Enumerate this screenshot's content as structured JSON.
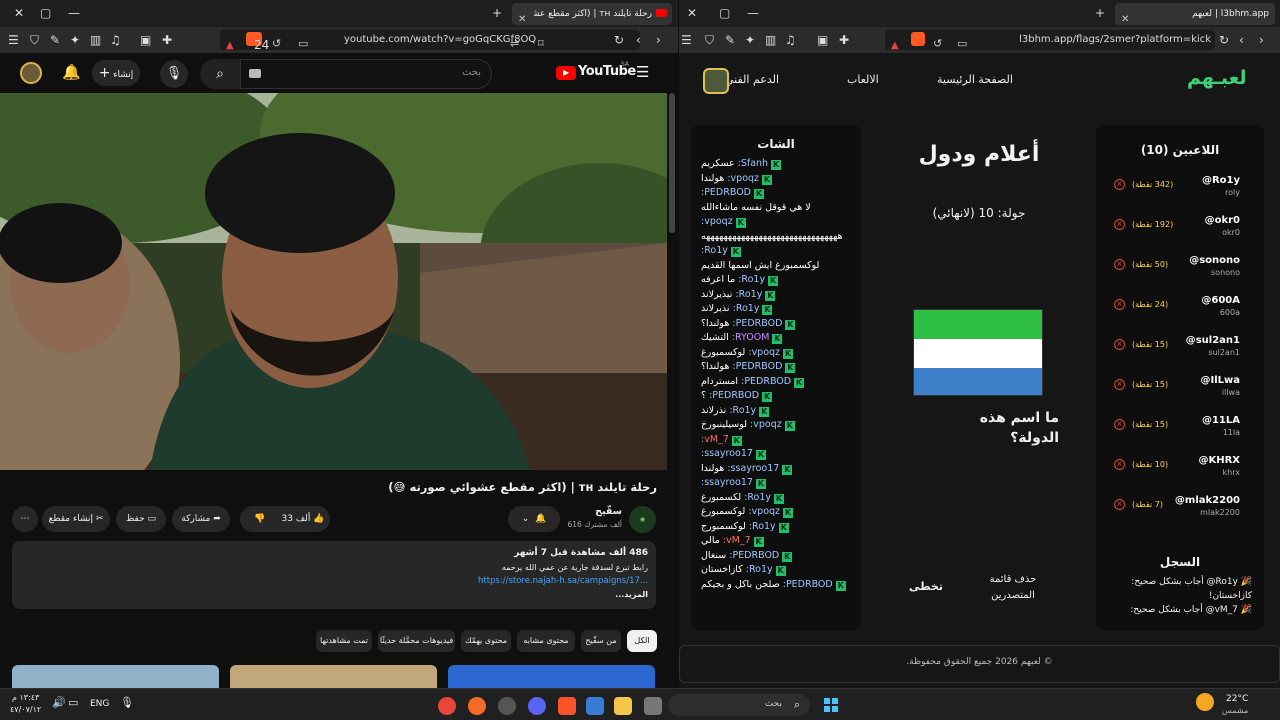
{
  "left_browser": {
    "tab_title": "رحلة تايلند ᴛʜ | (اكثر مقطع عشوائي صورته",
    "url": "youtube.com/watch?v=goGqCKGf8OQ",
    "shield_count": "24"
  },
  "youtube": {
    "logo_text": "YouTube",
    "logo_region": "SA",
    "search_placeholder": "بحث",
    "create_label": "إنشاء",
    "video_title": "رحلة تايلند ᴛʜ | (اكثر مقطع عشوائي صورته 😅)",
    "channel_name": "سقّيح",
    "subscribers": "616 ألف مشترك",
    "likes": "33 ألف",
    "share_label": "مشاركة",
    "save_label": "حفظ",
    "clip_label": "إنشاء مقطع",
    "desc_stats": "486 ألف مشاهدة قبل 7 أشهر",
    "desc_line": "رابط تبرع لسدقة جارية عن عمي الله يرحمه",
    "desc_link": "https://store.najah-h.sa/campaigns/17...",
    "desc_more": "...المزيد",
    "chips": [
      "الكل",
      "من سقّيح",
      "محتوى مشابه",
      "محتوى يهمّك",
      "فيديوهات محمَّلة حديثًا",
      "تمت مشاهدتها"
    ]
  },
  "right_browser": {
    "tab_title": "لعبهم | l3bhm.app",
    "url": "l3bhm.app/flags/2smer?platform=kick"
  },
  "game": {
    "logo": "لعبـهم",
    "nav": [
      "الصفحة الرئيسية",
      "الالعاب",
      "الدعم الفني"
    ],
    "players_title": "اللاعبين (10)",
    "players": [
      {
        "name": "@Ro1y",
        "sub": "roly",
        "points": "(342 نقطة)"
      },
      {
        "name": "@okr0",
        "sub": "okr0",
        "points": "(192 نقطة)"
      },
      {
        "name": "@sonono",
        "sub": "sonono",
        "points": "(50 نقطة)"
      },
      {
        "name": "@600A",
        "sub": "600a",
        "points": "(24 نقطة)"
      },
      {
        "name": "@sul2an1",
        "sub": "sul2an1",
        "points": "(15 نقطة)"
      },
      {
        "name": "@IlLwa",
        "sub": "illwa",
        "points": "(15 نقطة)"
      },
      {
        "name": "@11LA",
        "sub": "11la",
        "points": "(15 نقطة)"
      },
      {
        "name": "@KHRX",
        "sub": "khrx",
        "points": "(10 نقطة)"
      },
      {
        "name": "@mlak2200",
        "sub": "mlak2200",
        "points": "(7 نقطة)"
      }
    ],
    "log_title": "السجل",
    "log_lines": [
      "🎉 Ro1y@ أجاب بشكل صحيح:",
      "كازاخستان!",
      "🎉 vM_7@ أجاب بشكل صحيح:"
    ],
    "game_title": "أعلام ودول",
    "round": "جولة: 10 (لانهائي)",
    "question": "ما اسم هذه الدولة؟",
    "flag_colors": [
      "#2fbf45",
      "#ffffff",
      "#3d7fc9"
    ],
    "leaderboard_btn": "حذف قائمة المتصدرين",
    "skip_btn": "تخطى",
    "chat_title": "الشات",
    "chat": [
      {
        "n": "Sfanh",
        "m": "عسكريم"
      },
      {
        "n": "vpoqz",
        "m": "هولندا"
      },
      {
        "n": "PEDRBOD",
        "m": ""
      },
      {
        "n": "",
        "m": "لا هي قوقل نفسه ماشاءالله"
      },
      {
        "n": "vpoqz",
        "m": ""
      },
      {
        "n": "",
        "m": "هههههههههههههههههههههههههههههههه"
      },
      {
        "n": "Ro1y",
        "m": ""
      },
      {
        "n": "",
        "m": "لوكسمبورغ ايش اسمها القديم"
      },
      {
        "n": "Ro1y",
        "m": "ما اعرفه"
      },
      {
        "n": "Ro1y",
        "m": "نيذيرلاند"
      },
      {
        "n": "Ro1y",
        "m": "نذيرلاند"
      },
      {
        "n": "PEDRBOD",
        "m": "هولندا؟"
      },
      {
        "n": "RYOOM",
        "m": "التشيك"
      },
      {
        "n": "vpoqz",
        "m": "لوكسمبورغ"
      },
      {
        "n": "PEDRBOD",
        "m": "هولندا؟"
      },
      {
        "n": "PEDRBOD",
        "m": "امستردام"
      },
      {
        "n": "PEDRBOD",
        "m": "؟"
      },
      {
        "n": "Ro1y",
        "m": "نذرلاند"
      },
      {
        "n": "vpoqz",
        "m": "لوسيلينبورخ"
      },
      {
        "n": "vM_7",
        "m": ""
      },
      {
        "n": "ssayroo17",
        "m": ""
      },
      {
        "n": "ssayroo17",
        "m": "هولندا"
      },
      {
        "n": "ssayroo17",
        "m": ""
      },
      {
        "n": "Ro1y",
        "m": "لكسمبورغ"
      },
      {
        "n": "vpoqz",
        "m": "لوكسمبورغ"
      },
      {
        "n": "Ro1y",
        "m": "لوكسمبورج"
      },
      {
        "n": "vM_7",
        "m": "مالي"
      },
      {
        "n": "PEDRBOD",
        "m": "سنغال"
      },
      {
        "n": "Ro1y",
        "m": "كازاخستان"
      },
      {
        "n": "PEDRBOD",
        "m": "صلجن باكل و بجيكم"
      }
    ],
    "footer": "© لعبهم 2026 جميع الحقوق محفوظة."
  },
  "taskbar": {
    "search_placeholder": "بحث",
    "weather_temp": "22°C",
    "weather_desc": "مشمس",
    "lang": "ENG",
    "time": "١٣:٤٣ م",
    "date": "٤٧/٠٧/١٢"
  }
}
